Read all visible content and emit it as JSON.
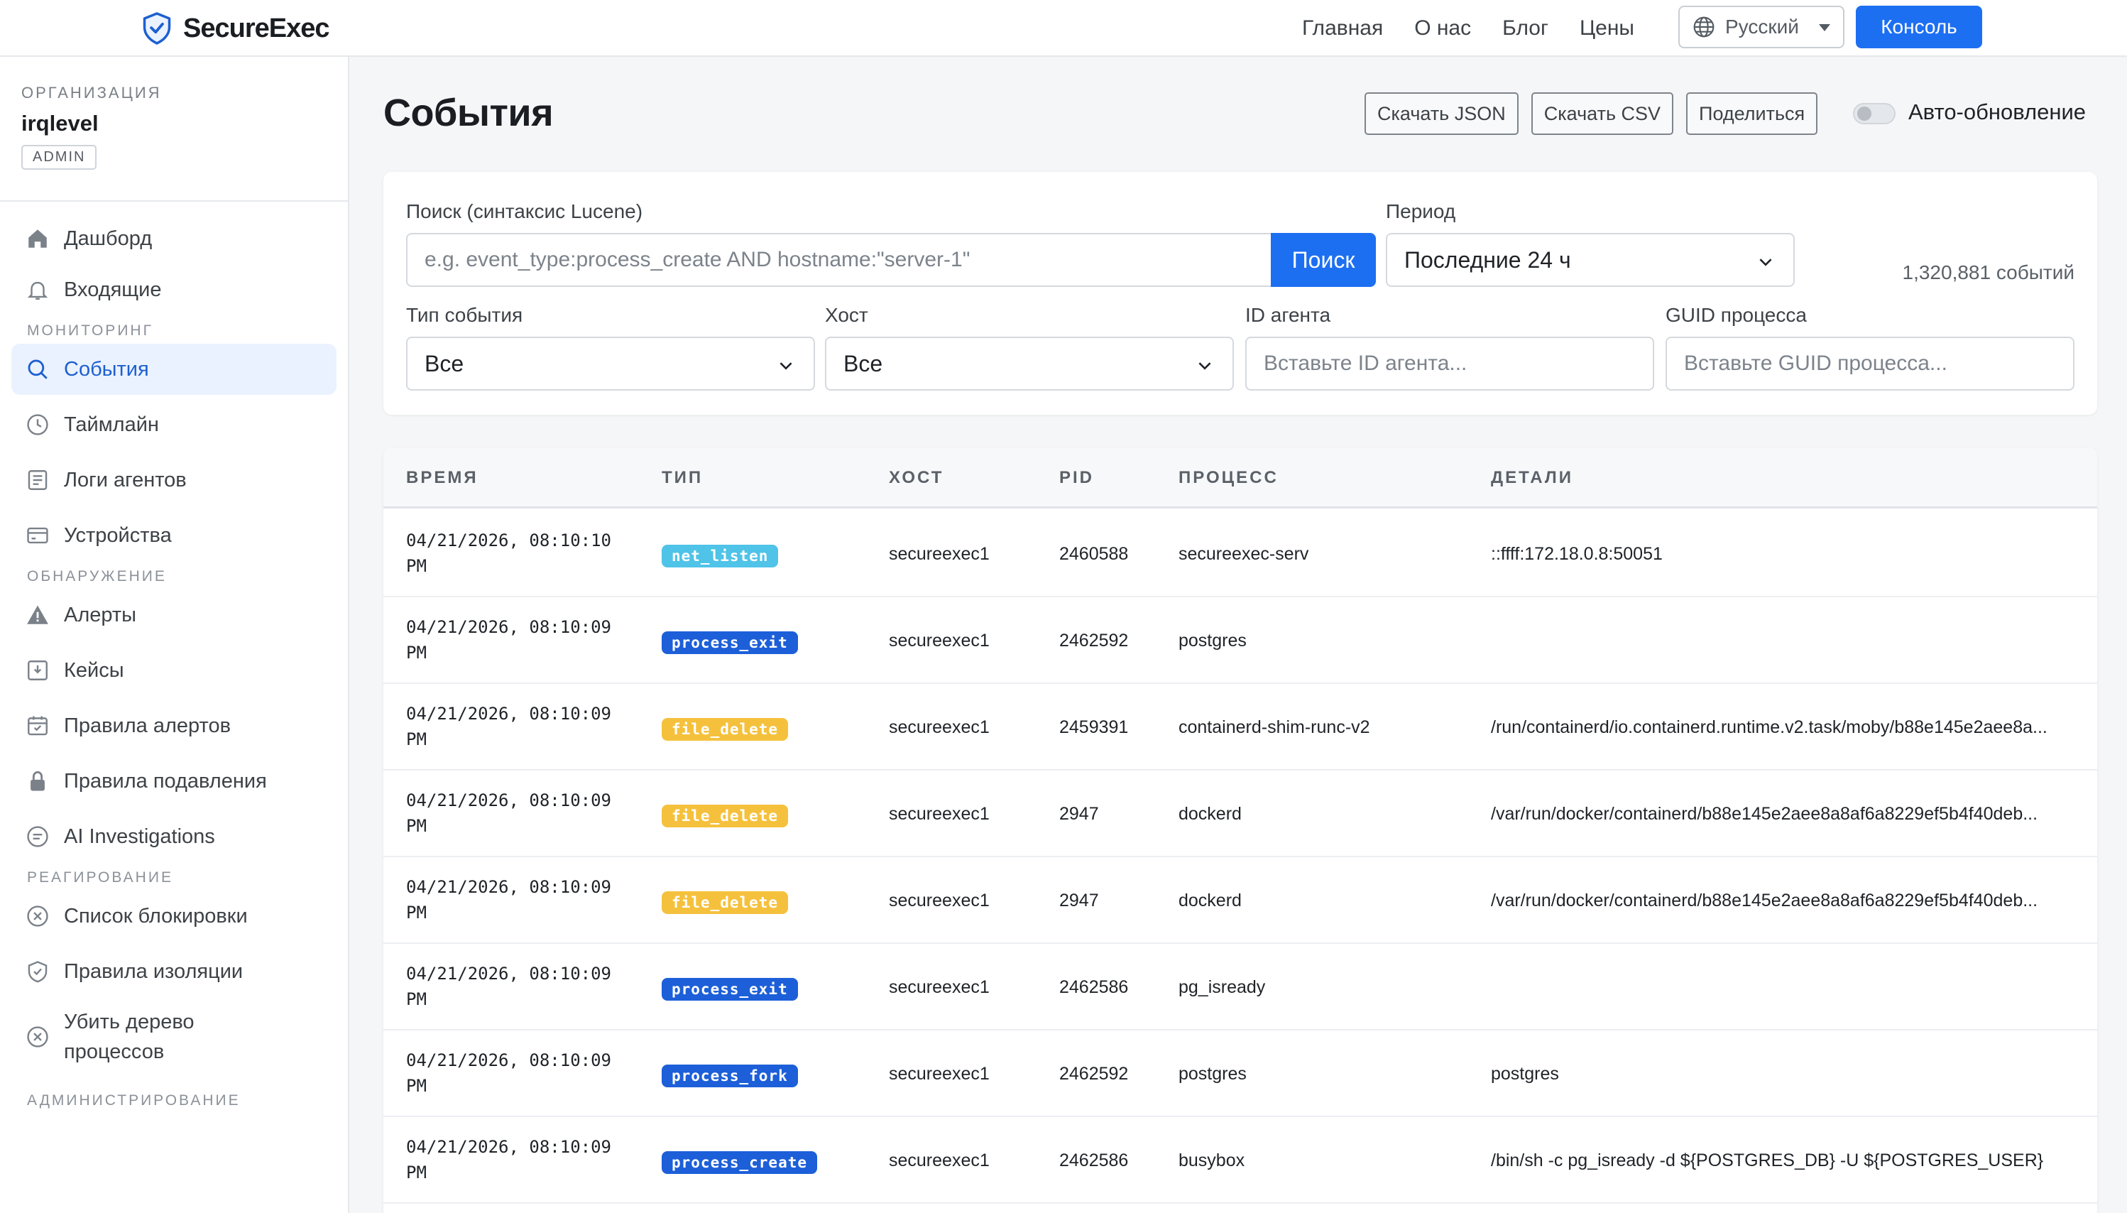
{
  "header": {
    "brand": "SecureExec",
    "nav": [
      "Главная",
      "О нас",
      "Блог",
      "Цены"
    ],
    "language": "Русский",
    "console": "Консоль"
  },
  "sidebar": {
    "org_label": "ОРГАНИЗАЦИЯ",
    "org_name": "irqlevel",
    "role": "ADMIN",
    "items": [
      {
        "label": "Дашборд",
        "icon": "home-icon"
      },
      {
        "label": "Входящие",
        "icon": "bell-icon"
      },
      {
        "section": "МОНИТОРИНГ"
      },
      {
        "label": "События",
        "icon": "search-icon",
        "active": true
      },
      {
        "label": "Таймлайн",
        "icon": "clock-icon"
      },
      {
        "label": "Логи агентов",
        "icon": "document-icon"
      },
      {
        "label": "Устройства",
        "icon": "card-icon"
      },
      {
        "section": "ОБНАРУЖЕНИЕ"
      },
      {
        "label": "Алерты",
        "icon": "warning-icon"
      },
      {
        "label": "Кейсы",
        "icon": "inbox-icon"
      },
      {
        "label": "Правила алертов",
        "icon": "calendar-icon"
      },
      {
        "label": "Правила подавления",
        "icon": "lock-icon"
      },
      {
        "label": "AI Investigations",
        "icon": "chat-icon"
      },
      {
        "section": "РЕАГИРОВАНИЕ"
      },
      {
        "label": "Список блокировки",
        "icon": "block-icon"
      },
      {
        "label": "Правила изоляции",
        "icon": "shield-icon"
      },
      {
        "label": "Убить дерево процессов",
        "icon": "kill-icon"
      },
      {
        "section": "АДМИНИСТРИРОВАНИЕ"
      }
    ]
  },
  "page": {
    "title": "События",
    "download_json": "Скачать JSON",
    "download_csv": "Скачать CSV",
    "share": "Поделиться",
    "auto_refresh": "Авто-обновление"
  },
  "filters": {
    "search_label": "Поиск (синтаксис Lucene)",
    "search_placeholder": "e.g. event_type:process_create AND hostname:\"server-1\"",
    "search_button": "Поиск",
    "period_label": "Период",
    "period_value": "Последние 24 ч",
    "count": "1,320,881 событий",
    "event_type_label": "Тип события",
    "event_type_value": "Все",
    "host_label": "Хост",
    "host_value": "Все",
    "agent_label": "ID агента",
    "agent_placeholder": "Вставьте ID агента...",
    "guid_label": "GUID процесса",
    "guid_placeholder": "Вставьте GUID процесса..."
  },
  "table": {
    "columns": [
      "ВРЕМЯ",
      "ТИП",
      "ХОСТ",
      "PID",
      "ПРОЦЕСС",
      "ДЕТАЛИ"
    ],
    "type_colors": {
      "net_listen": "#4fc3e8",
      "process_exit": "#1d5fd8",
      "file_delete": "#f5c13d",
      "process_fork": "#1d5fd8",
      "process_create": "#1d5fd8"
    },
    "rows": [
      {
        "time1": "04/21/2026, 08:10:10",
        "time2": "PM",
        "type": "net_listen",
        "host": "secureexec1",
        "pid": "2460588",
        "process": "secureexec-serv",
        "details": "::ffff:172.18.0.8:50051"
      },
      {
        "time1": "04/21/2026, 08:10:09",
        "time2": "PM",
        "type": "process_exit",
        "host": "secureexec1",
        "pid": "2462592",
        "process": "postgres",
        "details": ""
      },
      {
        "time1": "04/21/2026, 08:10:09",
        "time2": "PM",
        "type": "file_delete",
        "host": "secureexec1",
        "pid": "2459391",
        "process": "containerd-shim-runc-v2",
        "details": "/run/containerd/io.containerd.runtime.v2.task/moby/b88e145e2aee8a..."
      },
      {
        "time1": "04/21/2026, 08:10:09",
        "time2": "PM",
        "type": "file_delete",
        "host": "secureexec1",
        "pid": "2947",
        "process": "dockerd",
        "details": "/var/run/docker/containerd/b88e145e2aee8a8af6a8229ef5b4f40deb..."
      },
      {
        "time1": "04/21/2026, 08:10:09",
        "time2": "PM",
        "type": "file_delete",
        "host": "secureexec1",
        "pid": "2947",
        "process": "dockerd",
        "details": "/var/run/docker/containerd/b88e145e2aee8a8af6a8229ef5b4f40deb..."
      },
      {
        "time1": "04/21/2026, 08:10:09",
        "time2": "PM",
        "type": "process_exit",
        "host": "secureexec1",
        "pid": "2462586",
        "process": "pg_isready",
        "details": ""
      },
      {
        "time1": "04/21/2026, 08:10:09",
        "time2": "PM",
        "type": "process_fork",
        "host": "secureexec1",
        "pid": "2462592",
        "process": "postgres",
        "details": "postgres"
      },
      {
        "time1": "04/21/2026, 08:10:09",
        "time2": "PM",
        "type": "process_create",
        "host": "secureexec1",
        "pid": "2462586",
        "process": "busybox",
        "details": "/bin/sh -c pg_isready -d ${POSTGRES_DB} -U ${POSTGRES_USER}"
      }
    ]
  }
}
